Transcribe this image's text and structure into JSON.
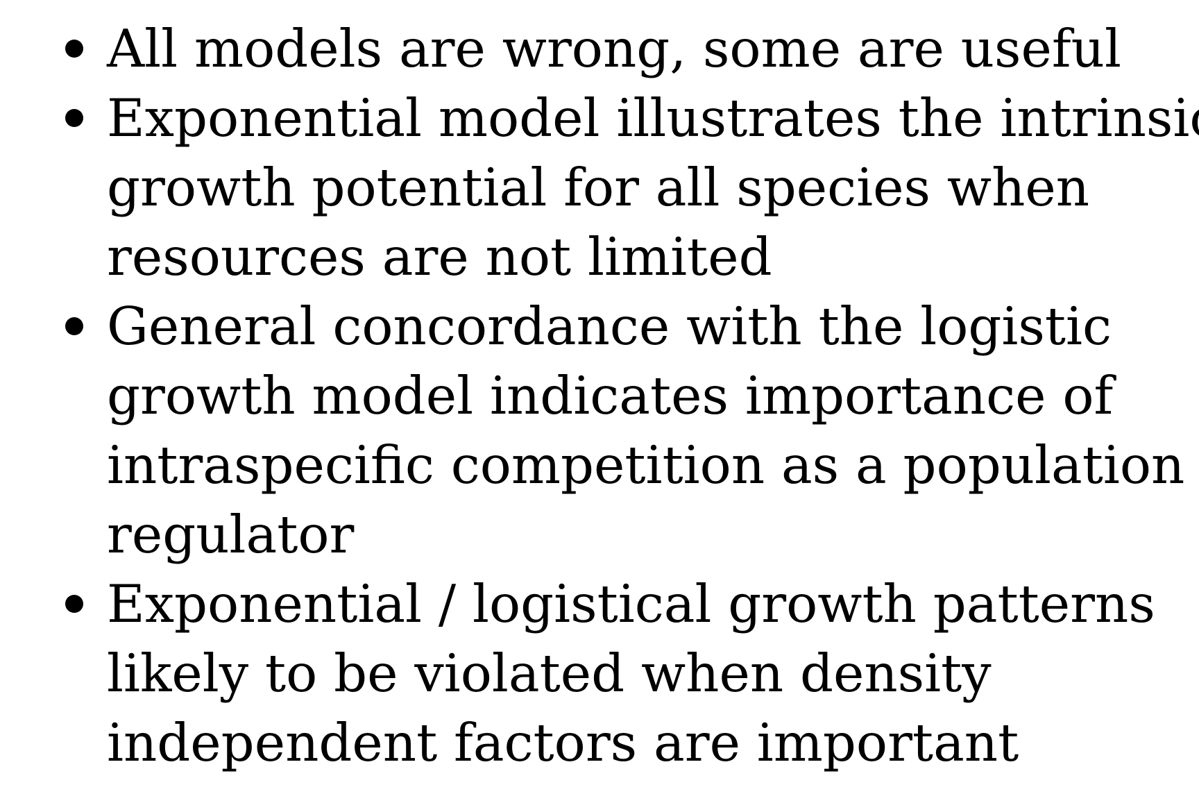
{
  "slide": {
    "bullets": [
      {
        "lines": [
          "All models are wrong, some are useful"
        ]
      },
      {
        "lines": [
          "Exponential model illustrates the intrinsic",
          "growth potential for all species when",
          "resources are not limited"
        ]
      },
      {
        "lines": [
          "General concordance with the logistic",
          "growth model indicates importance of",
          "intraspecific competition as a population",
          "regulator"
        ]
      },
      {
        "lines": [
          "Exponential / logistical growth patterns",
          "likely to be violated when density",
          "independent factors are important"
        ]
      }
    ]
  },
  "icons": {
    "bullet": "bullet-dot-icon"
  },
  "colors": {
    "background": "#ffffff",
    "text": "#000000"
  }
}
